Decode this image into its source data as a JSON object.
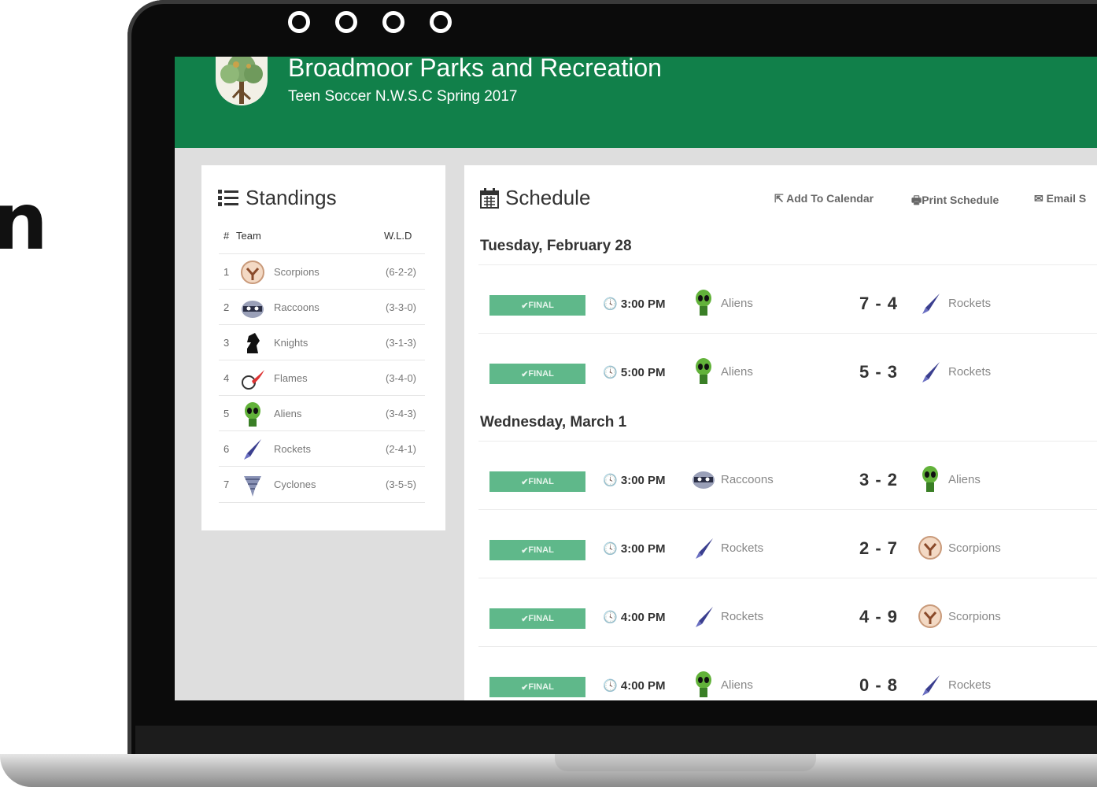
{
  "side_glyph": "n",
  "app": {
    "org_title": "Broadmoor Parks and Recreation",
    "league_subtitle": "Teen Soccer N.W.S.C Spring 2017"
  },
  "colors": {
    "header": "#11804a",
    "badge": "#5fb88a"
  },
  "standings": {
    "title": "Standings",
    "icon": "list-icon",
    "headers": {
      "rank": "#",
      "team": "Team",
      "wld": "W.L.D"
    },
    "rows": [
      {
        "rank": "1",
        "team": "Scorpions",
        "wld": "(6-2-2)",
        "icon": "scorpion-icon"
      },
      {
        "rank": "2",
        "team": "Raccoons",
        "wld": "(3-3-0)",
        "icon": "raccoon-icon"
      },
      {
        "rank": "3",
        "team": "Knights",
        "wld": "(3-1-3)",
        "icon": "knight-icon"
      },
      {
        "rank": "4",
        "team": "Flames",
        "wld": "(3-4-0)",
        "icon": "flame-ball-icon"
      },
      {
        "rank": "5",
        "team": "Aliens",
        "wld": "(3-4-3)",
        "icon": "alien-icon"
      },
      {
        "rank": "6",
        "team": "Rockets",
        "wld": "(2-4-1)",
        "icon": "rocket-icon"
      },
      {
        "rank": "7",
        "team": "Cyclones",
        "wld": "(3-5-5)",
        "icon": "cyclone-icon"
      }
    ]
  },
  "schedule": {
    "title": "Schedule",
    "icon": "calendar-icon",
    "links": {
      "add_calendar": "Add To Calendar",
      "print": "Print Schedule",
      "email": "Email S"
    },
    "days": [
      {
        "date": "Tuesday, February 28",
        "games": [
          {
            "status": "FINAL",
            "time": "3:00 PM",
            "home": "Aliens",
            "home_icon": "alien-icon",
            "score": "7 - 4",
            "away": "Rockets",
            "away_icon": "rocket-icon"
          },
          {
            "status": "FINAL",
            "time": "5:00 PM",
            "home": "Aliens",
            "home_icon": "alien-icon",
            "score": "5 - 3",
            "away": "Rockets",
            "away_icon": "rocket-icon"
          }
        ]
      },
      {
        "date": "Wednesday, March 1",
        "games": [
          {
            "status": "FINAL",
            "time": "3:00 PM",
            "home": "Raccoons",
            "home_icon": "raccoon-icon",
            "score": "3 - 2",
            "away": "Aliens",
            "away_icon": "alien-icon"
          },
          {
            "status": "FINAL",
            "time": "3:00 PM",
            "home": "Rockets",
            "home_icon": "rocket-icon",
            "score": "2 - 7",
            "away": "Scorpions",
            "away_icon": "scorpion-icon"
          },
          {
            "status": "FINAL",
            "time": "4:00 PM",
            "home": "Rockets",
            "home_icon": "rocket-icon",
            "score": "4 - 9",
            "away": "Scorpions",
            "away_icon": "scorpion-icon"
          },
          {
            "status": "FINAL",
            "time": "4:00 PM",
            "home": "Aliens",
            "home_icon": "alien-icon",
            "score": "0 - 8",
            "away": "Rockets",
            "away_icon": "rocket-icon"
          }
        ]
      }
    ]
  }
}
